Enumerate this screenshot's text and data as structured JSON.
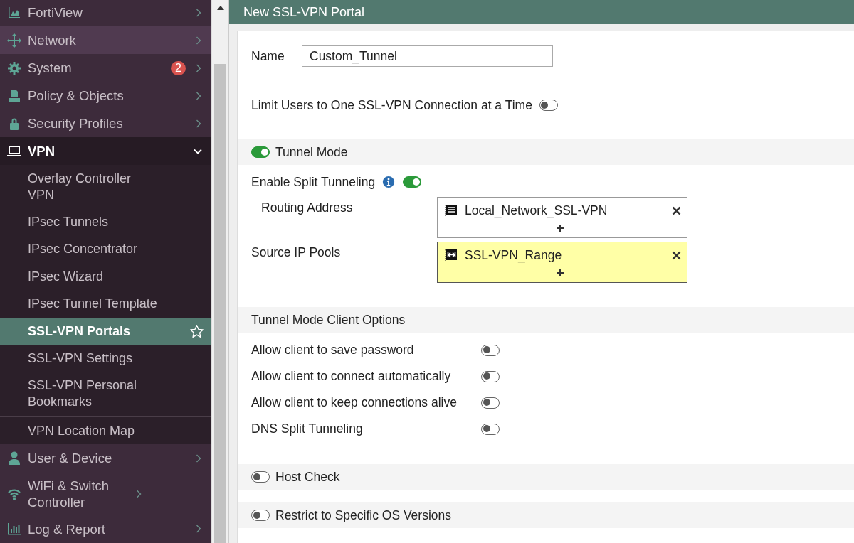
{
  "sidebar": {
    "items": [
      {
        "label": "FortiView",
        "hovered": false,
        "expanded": false
      },
      {
        "label": "Network",
        "hovered": true,
        "expanded": false
      },
      {
        "label": "System",
        "hovered": false,
        "expanded": false,
        "badge": "2"
      },
      {
        "label": "Policy & Objects",
        "hovered": false,
        "expanded": false
      },
      {
        "label": "Security Profiles",
        "hovered": false,
        "expanded": false
      },
      {
        "label": "VPN",
        "hovered": false,
        "expanded": true,
        "children": [
          {
            "label": "Overlay Controller VPN",
            "selected": false
          },
          {
            "label": "IPsec Tunnels",
            "selected": false
          },
          {
            "label": "IPsec Concentrator",
            "selected": false
          },
          {
            "label": "IPsec Wizard",
            "selected": false
          },
          {
            "label": "IPsec Tunnel Template",
            "selected": false
          },
          {
            "label": "SSL-VPN Portals",
            "selected": true
          },
          {
            "label": "SSL-VPN Settings",
            "selected": false
          },
          {
            "label": "SSL-VPN Personal Bookmarks",
            "selected": false
          },
          {
            "label": "VPN Location Map",
            "selected": false
          }
        ]
      },
      {
        "label": "User & Device",
        "hovered": false,
        "expanded": false
      },
      {
        "label": "WiFi & Switch Controller",
        "hovered": false,
        "expanded": false
      },
      {
        "label": "Log & Report",
        "hovered": false,
        "expanded": false
      }
    ]
  },
  "panel": {
    "title": "New SSL-VPN Portal",
    "name": {
      "label": "Name",
      "value": "Custom_Tunnel"
    },
    "limit_users": {
      "label": "Limit Users to One SSL-VPN Connection at a Time",
      "on": false
    },
    "tunnel_mode": {
      "label": "Tunnel Mode",
      "on": true
    },
    "split_tunneling": {
      "label": "Enable Split Tunneling",
      "on": true
    },
    "address_fields": [
      {
        "label": "Routing Address",
        "indented": true,
        "highlighted": false,
        "kind": "address",
        "entry": "Local_Network_SSL-VPN"
      },
      {
        "label": "Source IP Pools",
        "indented": false,
        "highlighted": true,
        "kind": "range",
        "entry": "SSL-VPN_Range"
      }
    ],
    "client_options": {
      "label": "Tunnel Mode Client Options",
      "options": [
        {
          "label": "Allow client to save password",
          "on": false
        },
        {
          "label": "Allow client to connect automatically",
          "on": false
        },
        {
          "label": "Allow client to keep connections alive",
          "on": false
        },
        {
          "label": "DNS Split Tunneling",
          "on": false
        }
      ]
    },
    "sections": [
      {
        "label": "Host Check",
        "on": false
      },
      {
        "label": "Restrict to Specific OS Versions",
        "on": false
      }
    ]
  }
}
